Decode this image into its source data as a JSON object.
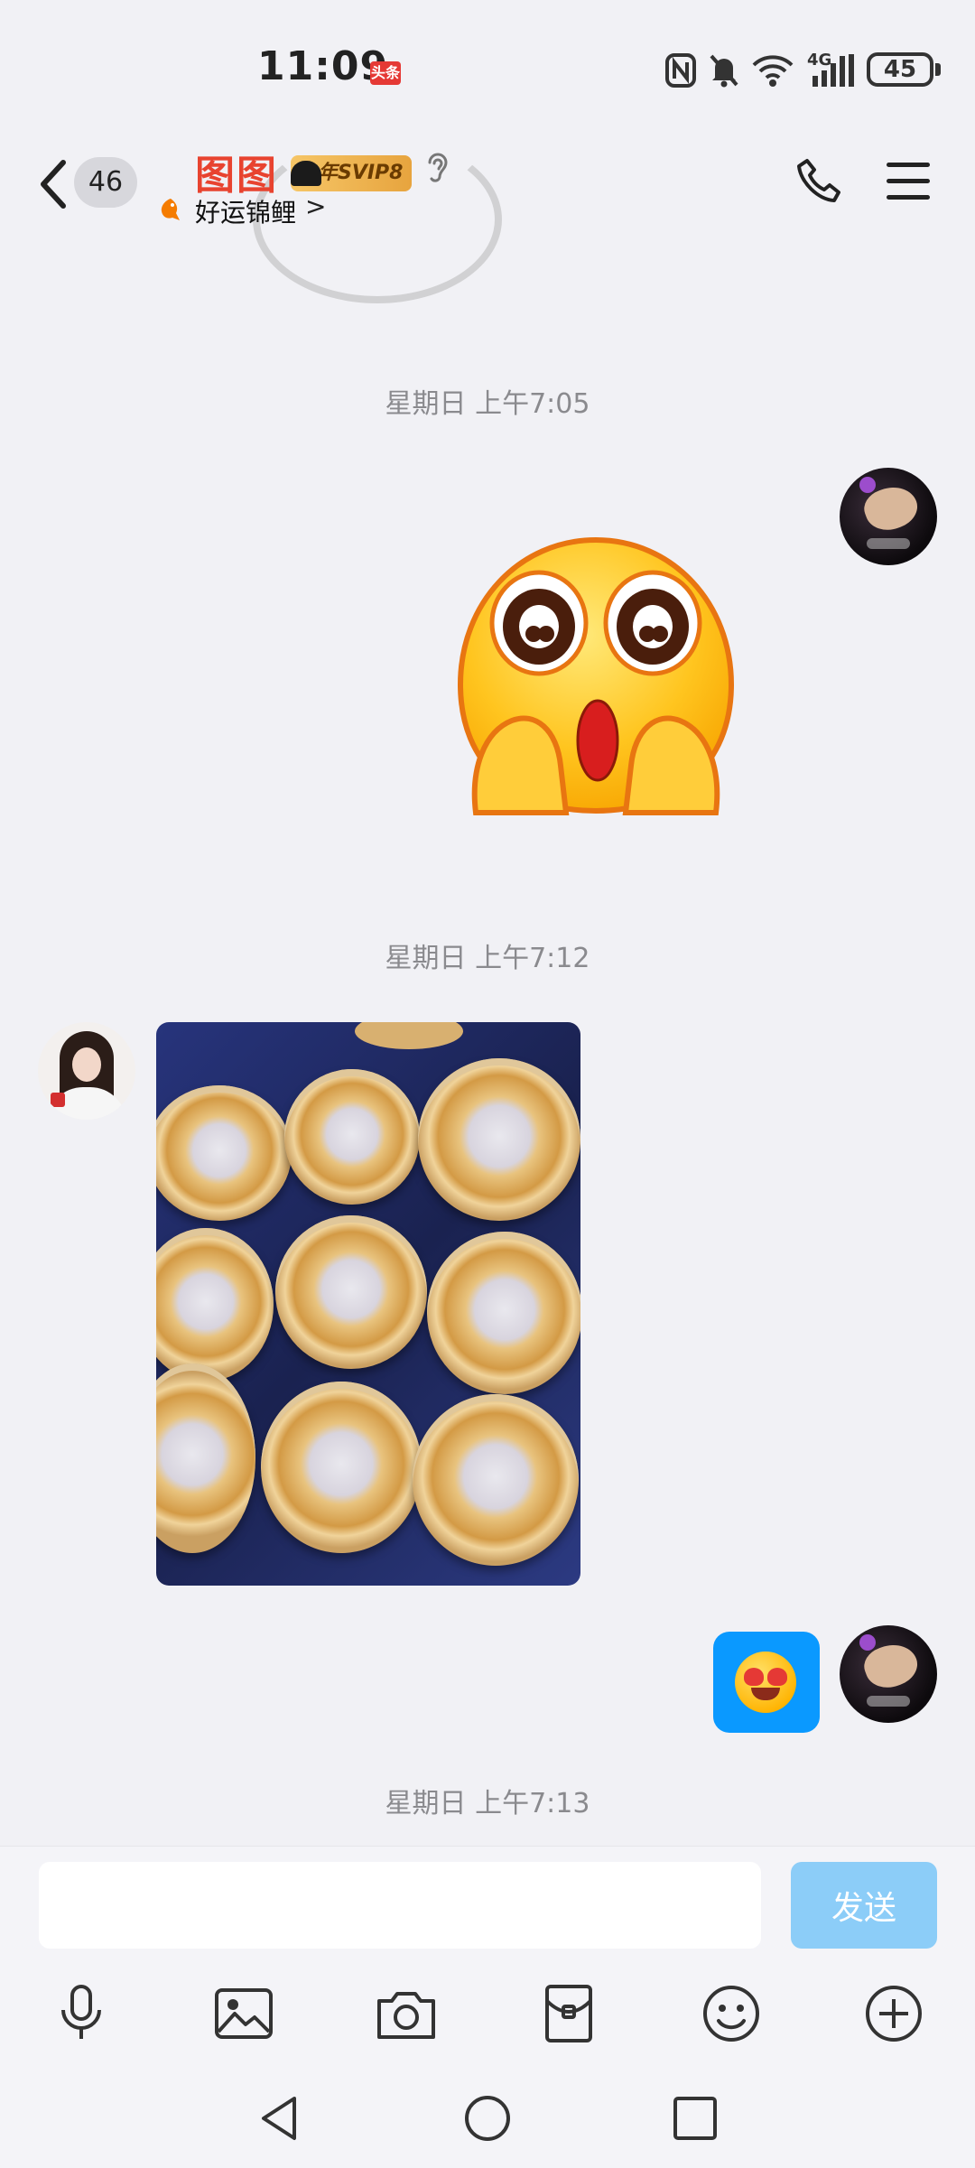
{
  "status_bar": {
    "time": "11:09",
    "news_badge": "头条",
    "network": "4G",
    "battery": "45"
  },
  "header": {
    "unread_count": "46",
    "contact_name": "图图",
    "vip_label": "年SVIP8",
    "sub_status": "好运锦鲤",
    "sub_status_chevron": ">"
  },
  "messages": [
    {
      "type": "timestamp",
      "text": "星期日 上午7:05"
    },
    {
      "type": "sticker",
      "sender": "me",
      "icon": "shocked-emoji-sticker"
    },
    {
      "type": "timestamp",
      "text": "星期日 上午7:12"
    },
    {
      "type": "image",
      "sender": "contact",
      "content": "photo-of-pastries"
    },
    {
      "type": "emoji",
      "sender": "me",
      "icon": "heart-eyes-emoji"
    },
    {
      "type": "timestamp",
      "text": "星期日 上午7:13"
    }
  ],
  "composer": {
    "input_value": "",
    "send_label": "发送"
  },
  "toolbar": [
    "microphone-icon",
    "image-icon",
    "camera-icon",
    "red-packet-icon",
    "emoji-icon",
    "plus-icon"
  ],
  "colors": {
    "accent": "#0a99ff",
    "send_disabled": "#8ccdf8",
    "name": "#e8432f",
    "background": "#f1f1f5"
  }
}
